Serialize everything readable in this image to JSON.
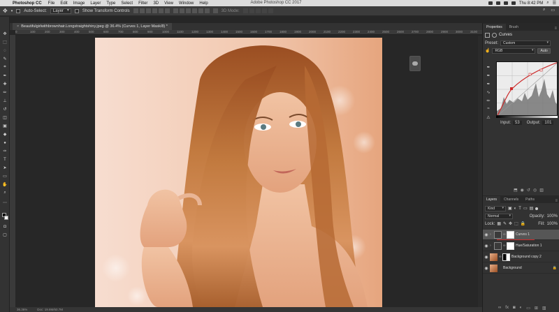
{
  "menubar": {
    "app": "Photoshop CC",
    "items": [
      "File",
      "Edit",
      "Image",
      "Layer",
      "Type",
      "Select",
      "Filter",
      "3D",
      "View",
      "Window",
      "Help"
    ],
    "window_title": "Adobe Photoshop CC 2017",
    "clock": "Thu 8:42 PM"
  },
  "options_bar": {
    "auto_select_label": "Auto-Select:",
    "auto_select_value": "Layer",
    "show_transform_label": "Show Transform Controls",
    "mode_3d_label": "3D Mode:"
  },
  "document": {
    "tab_title": "Beautifulgirlwithbrownhair.Longstraightshiny.jpeg @ 36.4% (Curves 1, Layer Mask/8) *",
    "zoom": "36.36%",
    "status": "Doc: 19.8M/60.7M"
  },
  "ruler_ticks": [
    "0",
    "100",
    "200",
    "300",
    "400",
    "500",
    "600",
    "700",
    "800",
    "900",
    "1000",
    "1100",
    "1200",
    "1300",
    "1400",
    "1500",
    "1600",
    "1700",
    "1800",
    "1900",
    "2000",
    "2100",
    "2200",
    "2300",
    "2400",
    "2500",
    "2600",
    "2700",
    "2800",
    "2900",
    "3000",
    "3100"
  ],
  "properties_panel": {
    "tabs": [
      "Properties",
      "Brush"
    ],
    "adjustment_name": "Curves",
    "preset_label": "Preset:",
    "preset_value": "Custom",
    "channel_value": "RGB",
    "auto_label": "Auto",
    "input_label": "Input:",
    "input_value": "53",
    "output_label": "Output:",
    "output_value": "101"
  },
  "layers_panel": {
    "tabs": [
      "Layers",
      "Channels",
      "Paths"
    ],
    "filter_kind": "Kind",
    "blend_mode": "Normal",
    "opacity_label": "Opacity:",
    "opacity_value": "100%",
    "lock_label": "Lock:",
    "fill_label": "Fill:",
    "fill_value": "100%",
    "layers": [
      {
        "name": "Curves 1",
        "selected": true
      },
      {
        "name": "Hue/Saturation 1",
        "selected": false
      },
      {
        "name": "Background copy 2",
        "selected": false
      },
      {
        "name": "Background",
        "selected": false
      }
    ]
  },
  "colors": {
    "accent_red": "#cc2b2b",
    "panel_bg": "#323232",
    "selected_layer": "#565656"
  }
}
